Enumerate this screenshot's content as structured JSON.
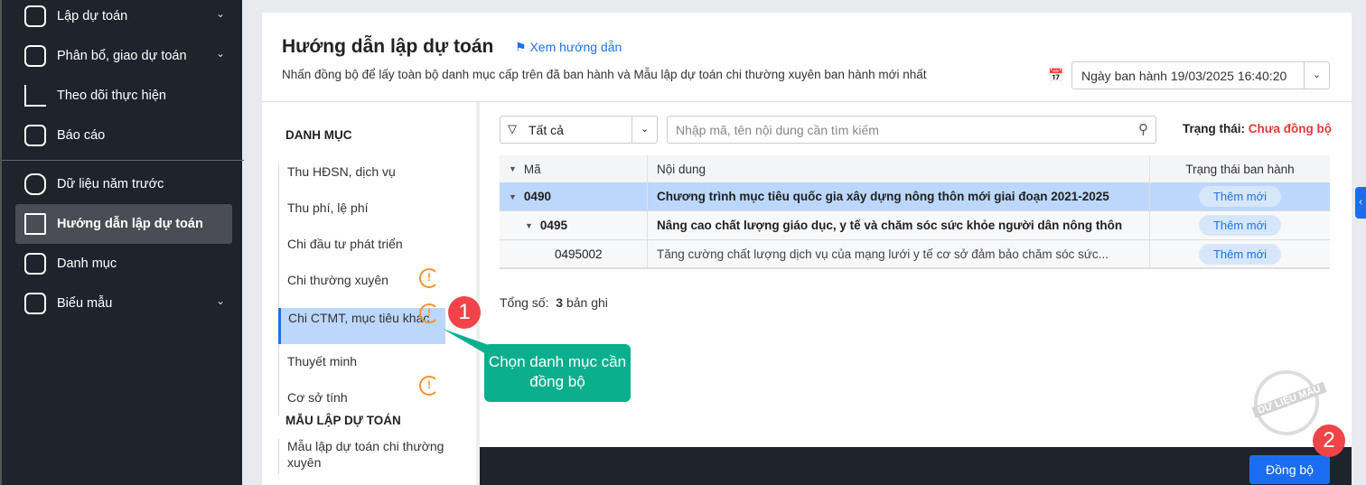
{
  "sidebar": {
    "items": [
      {
        "label": "Lập dự toán",
        "chevron": true
      },
      {
        "label": "Phân bổ, giao dự toán",
        "chevron": true
      },
      {
        "label": "Theo dõi thực hiện"
      },
      {
        "label": "Báo cáo"
      },
      {
        "label": "Dữ liệu năm trước"
      },
      {
        "label": "Hướng dẫn lập dự toán",
        "active": true
      },
      {
        "label": "Danh mục"
      },
      {
        "label": "Biểu mẫu",
        "chevron": true
      }
    ]
  },
  "header": {
    "title": "Hướng dẫn lập dự toán",
    "guide_link": "Xem hướng dẫn",
    "subtitle": "Nhấn đồng bộ để lấy toàn bộ danh mục cấp trên đã ban hành và Mẫu lập dự toán chi thường xuyên ban hành mới nhất",
    "date": "Ngày ban hành 19/03/2025 16:40:20"
  },
  "left": {
    "section1": "DANH MỤC",
    "categories": [
      "Thu HĐSN, dịch vụ",
      "Thu phí, lệ phí",
      "Chi đầu tư phát triển",
      "Chi thường xuyên",
      "Chi CTMT, mục tiêu khác",
      "Thuyết minh",
      "Cơ sở tính"
    ],
    "section2": "MẪU LẬP DỰ TOÁN",
    "templates": [
      "Mẫu lập dự toán chi thường xuyên"
    ]
  },
  "annotations": {
    "badge1": "1",
    "badge2": "2",
    "callout": "Chọn danh mục cần đồng bộ",
    "stamp": "DỮ LIỆU MẪU"
  },
  "toolbar": {
    "filter": "Tất cả",
    "search_placeholder": "Nhập mã, tên nội dung cần tìm kiếm",
    "status_label": "Trạng thái:",
    "status_value": "Chưa đồng bộ"
  },
  "table": {
    "headers": [
      "Mã",
      "Nội dung",
      "Trạng thái ban hành"
    ],
    "rows": [
      {
        "code": "0490",
        "content": "Chương trình mục tiêu quốc gia xây dựng nông thôn mới giai đoạn 2021-2025",
        "status": "Thêm mới"
      },
      {
        "code": "0495",
        "content": "Nâng cao chất lượng giáo dục, y tế và chăm sóc sức khỏe người dân nông thôn",
        "status": "Thêm mới"
      },
      {
        "code": "0495002",
        "content": "Tăng cường chất lượng dịch vụ của mạng lưới y tế cơ sở đảm bảo chăm sóc sức...",
        "status": "Thêm mới"
      }
    ]
  },
  "total": {
    "label": "Tổng số:",
    "count": "3",
    "unit": "bản ghi"
  },
  "footer": {
    "sync_button": "Đồng bộ"
  },
  "colors": {
    "sidebar": "#1f232b",
    "accent": "#1a6df0",
    "warning": "#f5922c",
    "danger": "#e53935",
    "callout": "#0caf8d"
  }
}
